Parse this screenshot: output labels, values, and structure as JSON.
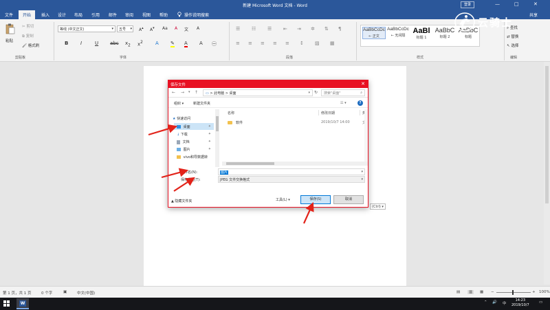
{
  "window": {
    "title": "新建 Microsoft Word 文档 - Word",
    "login_label": "登录",
    "controls": [
      "—",
      "□",
      "✕"
    ]
  },
  "ribbon_tabs": [
    "文件",
    "开始",
    "插入",
    "设计",
    "布局",
    "引用",
    "邮件",
    "审阅",
    "视图",
    "帮助"
  ],
  "tell_me": "操作说明搜索",
  "share_label": "共享",
  "clipboard": {
    "paste": "粘贴",
    "cut": "剪切",
    "copy": "复制",
    "format_painter": "格式刷",
    "group": "剪贴板"
  },
  "font": {
    "name": "等线 (中文正文)",
    "size": "五号",
    "group": "字体"
  },
  "paragraph": {
    "group": "段落"
  },
  "styles": {
    "items": [
      {
        "sample": "AaBbCcDc",
        "name": "← 正文"
      },
      {
        "sample": "AaBbCcDc",
        "name": "← 无间隔"
      },
      {
        "sample": "AaBl",
        "name": "标题 1"
      },
      {
        "sample": "AaBbC",
        "name": "标题 2"
      },
      {
        "sample": "AaBbC",
        "name": "标题"
      }
    ],
    "group": "样式"
  },
  "editing": {
    "find": "查找",
    "replace": "替换",
    "select": "选择",
    "group": "编辑"
  },
  "watermark_text": "云骑士",
  "dialog": {
    "title": "保存文件",
    "path": "> 此电脑 > 桌面",
    "search_placeholder": "搜索\"桌面\"",
    "organize": "组织 ▾",
    "new_folder": "新建文件夹",
    "help": "?",
    "nav_items": [
      {
        "label": "快速访问",
        "pinned": false,
        "selected": false
      },
      {
        "label": "桌面",
        "pinned": true,
        "selected": true
      },
      {
        "label": "下载",
        "pinned": true,
        "selected": false
      },
      {
        "label": "文档",
        "pinned": true,
        "selected": false
      },
      {
        "label": "图片",
        "pinned": true,
        "selected": false
      },
      {
        "label": "vivo和导数据转",
        "pinned": false,
        "selected": false
      }
    ],
    "columns": {
      "name": "名称",
      "modified": "修改日期",
      "type": "类"
    },
    "files": [
      {
        "name": "软件",
        "modified": "2019/10/7 14:00",
        "type": "文"
      }
    ],
    "filename_label": "文件名(N):",
    "filename_value": "图片",
    "filetype_label": "保存类型(T):",
    "filetype_value": "JPEG 文件交换格式",
    "hide_folders": "▲ 隐藏文件夹",
    "tools": "工具(L) ▾",
    "save": "保存(S)",
    "cancel": "取消"
  },
  "paste_ctrl_tag": "(Ctrl) ▾",
  "status": {
    "page": "第 1 页，共 1 页",
    "words": "0 个字",
    "language": "中文(中国)",
    "zoom": "100%"
  },
  "taskbar": {
    "tray_icons": [
      "⌃",
      "🔊",
      "中"
    ],
    "time": "14:23",
    "date": "2019/10/7"
  },
  "colors": {
    "brand": "#2b579a",
    "dialog_accent": "#e81123",
    "arrow": "#e2231a"
  }
}
